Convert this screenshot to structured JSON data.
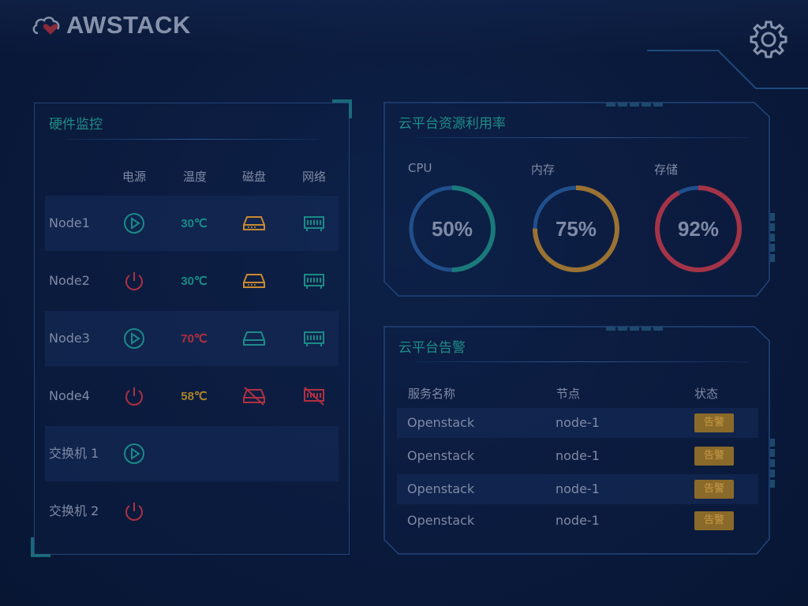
{
  "header": {
    "brand": "AWSTACK"
  },
  "hardware": {
    "title": "硬件监控",
    "columns": [
      "电源",
      "温度",
      "磁盘",
      "网络"
    ],
    "rows": [
      {
        "name": "Node1",
        "power": "play",
        "temp": "30℃",
        "temp_color": "#1a8a86",
        "disk": "ok",
        "disk_color": "#c98a2e",
        "net": "ok"
      },
      {
        "name": "Node2",
        "power": "power",
        "temp": "30℃",
        "temp_color": "#1a8a86",
        "disk": "ok",
        "disk_color": "#c98a2e",
        "net": "ok"
      },
      {
        "name": "Node3",
        "power": "play",
        "temp": "70℃",
        "temp_color": "#b03040",
        "disk": "ok",
        "disk_color": "#1f8a8a",
        "net": "ok"
      },
      {
        "name": "Node4",
        "power": "power",
        "temp": "58℃",
        "temp_color": "#a8822a",
        "disk": "error",
        "disk_color": "#b03040",
        "net": "error"
      },
      {
        "name": "交换机 1",
        "power": "play"
      },
      {
        "name": "交换机 2",
        "power": "power"
      }
    ]
  },
  "resources": {
    "title": "云平台资源利用率",
    "items": [
      {
        "label": "CPU",
        "value": "50%",
        "fraction": 0.5,
        "color": "#1a7a7a",
        "track": "#214f8c"
      },
      {
        "label": "内存",
        "value": "75%",
        "fraction": 0.75,
        "color": "#9a7232",
        "track": "#214f8c"
      },
      {
        "label": "存储",
        "value": "92%",
        "fraction": 0.92,
        "color": "#a33448",
        "track": "#214f8c"
      }
    ]
  },
  "alarms": {
    "title": "云平台告警",
    "columns": [
      "服务名称",
      "节点",
      "状态"
    ],
    "rows": [
      {
        "service": "Openstack",
        "node": "node-1",
        "status": "告警"
      },
      {
        "service": "Openstack",
        "node": "node-1",
        "status": "告警"
      },
      {
        "service": "Openstack",
        "node": "node-1",
        "status": "告警"
      },
      {
        "service": "Openstack",
        "node": "node-1",
        "status": "告警"
      }
    ]
  }
}
